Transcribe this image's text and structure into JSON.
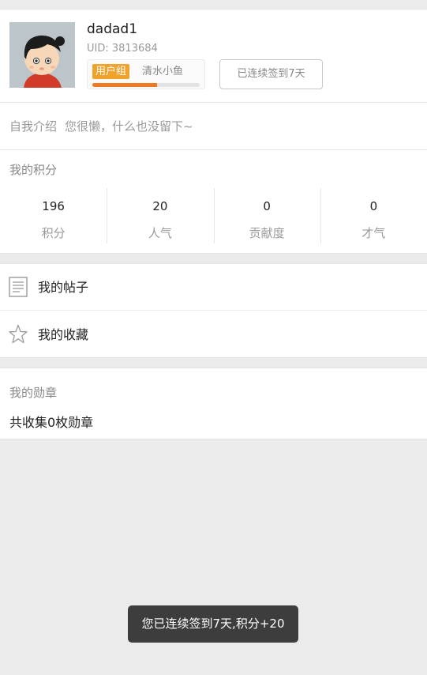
{
  "profile": {
    "username": "dadad1",
    "uid": "UID: 3813684",
    "group_tag": "用户组",
    "group_name": "清水小鱼",
    "group_progress": 0.6,
    "signin_label": "已连续签到7天"
  },
  "bio": {
    "label": "自我介绍",
    "text": "您很懒，什么也没留下~"
  },
  "points": {
    "title": "我的积分",
    "stats": [
      {
        "value": "196",
        "label": "积分"
      },
      {
        "value": "20",
        "label": "人气"
      },
      {
        "value": "0",
        "label": "贡献度"
      },
      {
        "value": "0",
        "label": "才气"
      }
    ]
  },
  "menu": {
    "items": [
      {
        "label": "我的帖子",
        "icon": "document-icon"
      },
      {
        "label": "我的收藏",
        "icon": "star-icon"
      }
    ]
  },
  "medals": {
    "title": "我的勋章",
    "count_text": "共收集0枚勋章"
  },
  "toast": {
    "text": "您已连续签到7天,积分+20"
  },
  "colors": {
    "accent_orange": "#f07a22",
    "group_tag_bg": "#f0a22a",
    "background": "#ebebeb"
  }
}
